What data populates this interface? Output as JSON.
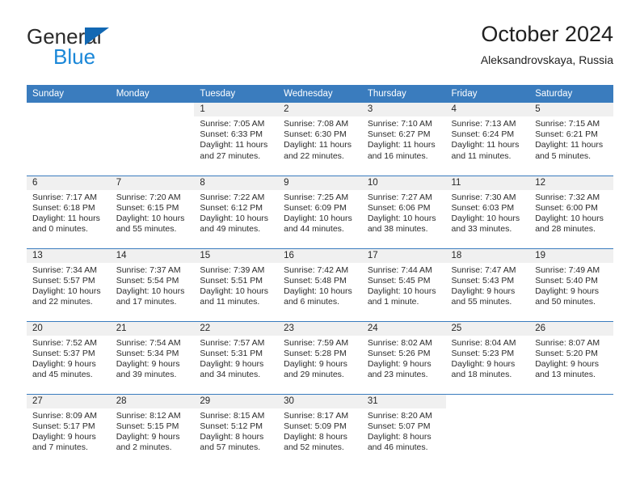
{
  "brand": {
    "name_part1": "General",
    "name_part2": "Blue",
    "triangle_color": "#1268b3",
    "blue_color": "#1a87d8"
  },
  "header": {
    "title": "October 2024",
    "location": "Aleksandrovskaya, Russia"
  },
  "theme": {
    "header_row_bg": "#3a7cbe",
    "daynum_bg": "#f0f0f0",
    "cell_border": "#3a7cbe",
    "text": "#2b2b2b"
  },
  "weekday_headers": [
    "Sunday",
    "Monday",
    "Tuesday",
    "Wednesday",
    "Thursday",
    "Friday",
    "Saturday"
  ],
  "weeks": [
    [
      {
        "day": "",
        "empty": true
      },
      {
        "day": "",
        "empty": true
      },
      {
        "day": "1",
        "sunrise": "Sunrise: 7:05 AM",
        "sunset": "Sunset: 6:33 PM",
        "daylight1": "Daylight: 11 hours",
        "daylight2": "and 27 minutes."
      },
      {
        "day": "2",
        "sunrise": "Sunrise: 7:08 AM",
        "sunset": "Sunset: 6:30 PM",
        "daylight1": "Daylight: 11 hours",
        "daylight2": "and 22 minutes."
      },
      {
        "day": "3",
        "sunrise": "Sunrise: 7:10 AM",
        "sunset": "Sunset: 6:27 PM",
        "daylight1": "Daylight: 11 hours",
        "daylight2": "and 16 minutes."
      },
      {
        "day": "4",
        "sunrise": "Sunrise: 7:13 AM",
        "sunset": "Sunset: 6:24 PM",
        "daylight1": "Daylight: 11 hours",
        "daylight2": "and 11 minutes."
      },
      {
        "day": "5",
        "sunrise": "Sunrise: 7:15 AM",
        "sunset": "Sunset: 6:21 PM",
        "daylight1": "Daylight: 11 hours",
        "daylight2": "and 5 minutes."
      }
    ],
    [
      {
        "day": "6",
        "sunrise": "Sunrise: 7:17 AM",
        "sunset": "Sunset: 6:18 PM",
        "daylight1": "Daylight: 11 hours",
        "daylight2": "and 0 minutes."
      },
      {
        "day": "7",
        "sunrise": "Sunrise: 7:20 AM",
        "sunset": "Sunset: 6:15 PM",
        "daylight1": "Daylight: 10 hours",
        "daylight2": "and 55 minutes."
      },
      {
        "day": "8",
        "sunrise": "Sunrise: 7:22 AM",
        "sunset": "Sunset: 6:12 PM",
        "daylight1": "Daylight: 10 hours",
        "daylight2": "and 49 minutes."
      },
      {
        "day": "9",
        "sunrise": "Sunrise: 7:25 AM",
        "sunset": "Sunset: 6:09 PM",
        "daylight1": "Daylight: 10 hours",
        "daylight2": "and 44 minutes."
      },
      {
        "day": "10",
        "sunrise": "Sunrise: 7:27 AM",
        "sunset": "Sunset: 6:06 PM",
        "daylight1": "Daylight: 10 hours",
        "daylight2": "and 38 minutes."
      },
      {
        "day": "11",
        "sunrise": "Sunrise: 7:30 AM",
        "sunset": "Sunset: 6:03 PM",
        "daylight1": "Daylight: 10 hours",
        "daylight2": "and 33 minutes."
      },
      {
        "day": "12",
        "sunrise": "Sunrise: 7:32 AM",
        "sunset": "Sunset: 6:00 PM",
        "daylight1": "Daylight: 10 hours",
        "daylight2": "and 28 minutes."
      }
    ],
    [
      {
        "day": "13",
        "sunrise": "Sunrise: 7:34 AM",
        "sunset": "Sunset: 5:57 PM",
        "daylight1": "Daylight: 10 hours",
        "daylight2": "and 22 minutes."
      },
      {
        "day": "14",
        "sunrise": "Sunrise: 7:37 AM",
        "sunset": "Sunset: 5:54 PM",
        "daylight1": "Daylight: 10 hours",
        "daylight2": "and 17 minutes."
      },
      {
        "day": "15",
        "sunrise": "Sunrise: 7:39 AM",
        "sunset": "Sunset: 5:51 PM",
        "daylight1": "Daylight: 10 hours",
        "daylight2": "and 11 minutes."
      },
      {
        "day": "16",
        "sunrise": "Sunrise: 7:42 AM",
        "sunset": "Sunset: 5:48 PM",
        "daylight1": "Daylight: 10 hours",
        "daylight2": "and 6 minutes."
      },
      {
        "day": "17",
        "sunrise": "Sunrise: 7:44 AM",
        "sunset": "Sunset: 5:45 PM",
        "daylight1": "Daylight: 10 hours",
        "daylight2": "and 1 minute."
      },
      {
        "day": "18",
        "sunrise": "Sunrise: 7:47 AM",
        "sunset": "Sunset: 5:43 PM",
        "daylight1": "Daylight: 9 hours",
        "daylight2": "and 55 minutes."
      },
      {
        "day": "19",
        "sunrise": "Sunrise: 7:49 AM",
        "sunset": "Sunset: 5:40 PM",
        "daylight1": "Daylight: 9 hours",
        "daylight2": "and 50 minutes."
      }
    ],
    [
      {
        "day": "20",
        "sunrise": "Sunrise: 7:52 AM",
        "sunset": "Sunset: 5:37 PM",
        "daylight1": "Daylight: 9 hours",
        "daylight2": "and 45 minutes."
      },
      {
        "day": "21",
        "sunrise": "Sunrise: 7:54 AM",
        "sunset": "Sunset: 5:34 PM",
        "daylight1": "Daylight: 9 hours",
        "daylight2": "and 39 minutes."
      },
      {
        "day": "22",
        "sunrise": "Sunrise: 7:57 AM",
        "sunset": "Sunset: 5:31 PM",
        "daylight1": "Daylight: 9 hours",
        "daylight2": "and 34 minutes."
      },
      {
        "day": "23",
        "sunrise": "Sunrise: 7:59 AM",
        "sunset": "Sunset: 5:28 PM",
        "daylight1": "Daylight: 9 hours",
        "daylight2": "and 29 minutes."
      },
      {
        "day": "24",
        "sunrise": "Sunrise: 8:02 AM",
        "sunset": "Sunset: 5:26 PM",
        "daylight1": "Daylight: 9 hours",
        "daylight2": "and 23 minutes."
      },
      {
        "day": "25",
        "sunrise": "Sunrise: 8:04 AM",
        "sunset": "Sunset: 5:23 PM",
        "daylight1": "Daylight: 9 hours",
        "daylight2": "and 18 minutes."
      },
      {
        "day": "26",
        "sunrise": "Sunrise: 8:07 AM",
        "sunset": "Sunset: 5:20 PM",
        "daylight1": "Daylight: 9 hours",
        "daylight2": "and 13 minutes."
      }
    ],
    [
      {
        "day": "27",
        "sunrise": "Sunrise: 8:09 AM",
        "sunset": "Sunset: 5:17 PM",
        "daylight1": "Daylight: 9 hours",
        "daylight2": "and 7 minutes."
      },
      {
        "day": "28",
        "sunrise": "Sunrise: 8:12 AM",
        "sunset": "Sunset: 5:15 PM",
        "daylight1": "Daylight: 9 hours",
        "daylight2": "and 2 minutes."
      },
      {
        "day": "29",
        "sunrise": "Sunrise: 8:15 AM",
        "sunset": "Sunset: 5:12 PM",
        "daylight1": "Daylight: 8 hours",
        "daylight2": "and 57 minutes."
      },
      {
        "day": "30",
        "sunrise": "Sunrise: 8:17 AM",
        "sunset": "Sunset: 5:09 PM",
        "daylight1": "Daylight: 8 hours",
        "daylight2": "and 52 minutes."
      },
      {
        "day": "31",
        "sunrise": "Sunrise: 8:20 AM",
        "sunset": "Sunset: 5:07 PM",
        "daylight1": "Daylight: 8 hours",
        "daylight2": "and 46 minutes."
      },
      {
        "day": "",
        "empty": true
      },
      {
        "day": "",
        "empty": true
      }
    ]
  ]
}
